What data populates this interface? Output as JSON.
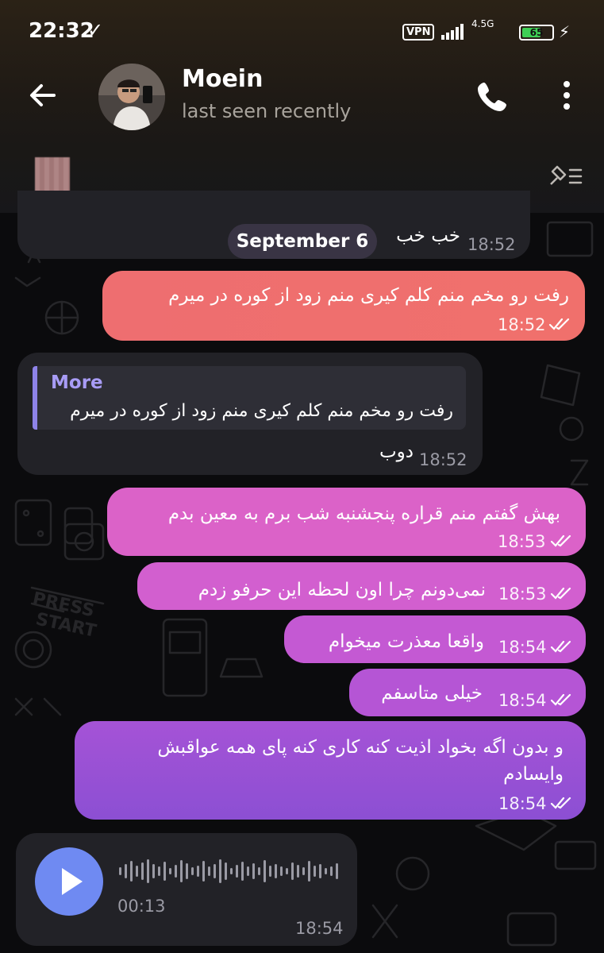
{
  "status_bar": {
    "time": "22:32",
    "vpn": "VPN",
    "network_type": "4.5G",
    "battery": "65",
    "battery_level": 0.65
  },
  "header": {
    "name": "Moein",
    "status": "last seen recently",
    "back_icon": "arrow-left-icon",
    "call_icon": "phone-icon",
    "menu_icon": "more-vertical-icon",
    "pinned_icon": "pinned-list-icon"
  },
  "colors": {
    "out_top": "#f16f6f",
    "out_mid": "#df63c2",
    "out_bottom": "#8c4fd3",
    "incoming": "#222227",
    "voice_accent": "#6f8af2",
    "reply_accent": "#a89cf6"
  },
  "chat": {
    "date_separator": "September 6",
    "messages": [
      {
        "id": "m0",
        "direction": "in",
        "text": "خب خب",
        "time": "18:52"
      },
      {
        "id": "m1",
        "direction": "out",
        "text": "رفت رو مخم منم کلم کیری منم زود از کوره در میرم",
        "time": "18:52",
        "read": true
      },
      {
        "id": "m2",
        "direction": "in",
        "reply_name": "More",
        "reply_text": "رفت رو مخم منم کلم کیری منم زود از کوره در میرم",
        "text": "دوب",
        "time": "18:52"
      },
      {
        "id": "m3",
        "direction": "out",
        "text": "بهش گفتم منم قراره پنجشنبه شب برم به معین بدم",
        "time": "18:53",
        "read": true
      },
      {
        "id": "m4",
        "direction": "out",
        "text": "نمی‌دونم چرا اون لحظه این حرفو زدم",
        "time": "18:53",
        "read": true
      },
      {
        "id": "m5",
        "direction": "out",
        "text": "واقعا معذرت میخوام",
        "time": "18:54",
        "read": true
      },
      {
        "id": "m6",
        "direction": "out",
        "text": "خیلی متاسفم",
        "time": "18:54",
        "read": true
      },
      {
        "id": "m7",
        "direction": "out",
        "text_line1": "و بدون اگه بخواد اذیت کنه کاری کنه پای همه عواقبش",
        "text_line2": "وایسادم",
        "time": "18:54",
        "read": true
      },
      {
        "id": "m8",
        "direction": "in",
        "type": "voice",
        "duration": "00:13",
        "time": "18:54",
        "play_icon": "play-icon"
      }
    ]
  }
}
